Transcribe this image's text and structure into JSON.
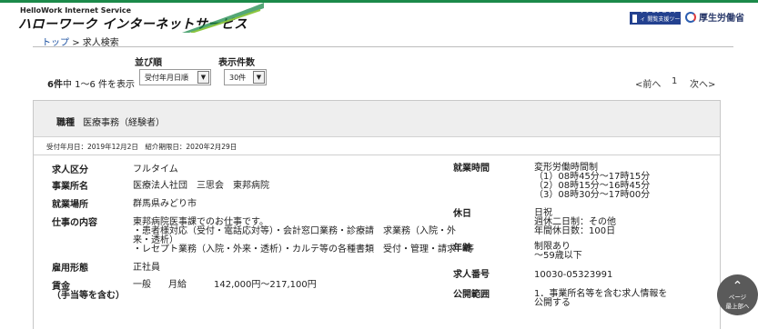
{
  "header": {
    "logo_en": "HelloWork Internet Service",
    "logo_jp": "ハローワーク インターネットサービス",
    "badge_text": "アクセシビリティ 閲覧支援ツール",
    "mhlw_label": "厚生労働省",
    "brand_color": "#1b8a4a"
  },
  "breadcrumb": {
    "top": "トップ",
    "separator": ">",
    "current": "求人検索"
  },
  "controls": {
    "sort_label": "並び順",
    "sort_value": "受付年月日順",
    "per_page_label": "表示件数",
    "per_page_value": "30件"
  },
  "results": {
    "total": "6件",
    "range": "中 1～6 件を表示"
  },
  "pager": {
    "prev": "<前へ",
    "page": "1",
    "next": "次へ>"
  },
  "job": {
    "occupation_label": "職種",
    "occupation_value": "医療事務（経験者）",
    "dates": "受付年月日：2019年12月2日　紹介期限日：2020年2月29日",
    "left": {
      "type_label": "求人区分",
      "type_value": "フルタイム",
      "company_label": "事業所名",
      "company_value": "医療法人社団　三思会　東邦病院",
      "location_label": "就業場所",
      "location_value": "群馬県みどり市",
      "duties_label": "仕事の内容",
      "duties_lines": [
        "東邦病院医事課でのお仕事です。",
        "・患者様対応（受付・電話応対等）・会計窓口業務・診療請　求業務（入院・外",
        "来・透析）",
        "・レセプト業務（入院・外来・透析）・カルテ等の各種書類　受付・管理・請求　等"
      ],
      "employment_label": "雇用形態",
      "employment_value": "正社員",
      "wage_label_1": "賃金",
      "wage_label_2": "（手当等を含む）",
      "wage_kind": "一般",
      "wage_unit": "月給",
      "wage_value": "142,000円～217,100円"
    },
    "right": {
      "hours_label": "就業時間",
      "hours_lines": [
        "変形労働時間制",
        "（1）08時45分～17時15分",
        "（2）08時15分～16時45分",
        "（3）08時30分～17時00分"
      ],
      "holiday_label": "休日",
      "holiday_lines": [
        "日祝",
        "週休二日制：その他",
        "年間休日数：100日"
      ],
      "age_label": "年齢",
      "age_lines": [
        "制限あり",
        "～59歳以下"
      ],
      "number_label": "求人番号",
      "number_value": "10030-05323991",
      "disclosure_label": "公開範囲",
      "disclosure_lines": [
        "1．事業所名等を含む求人情報を",
        "公開する"
      ]
    }
  },
  "scroll_top": {
    "line1": "ページ",
    "line2": "最上部へ"
  }
}
